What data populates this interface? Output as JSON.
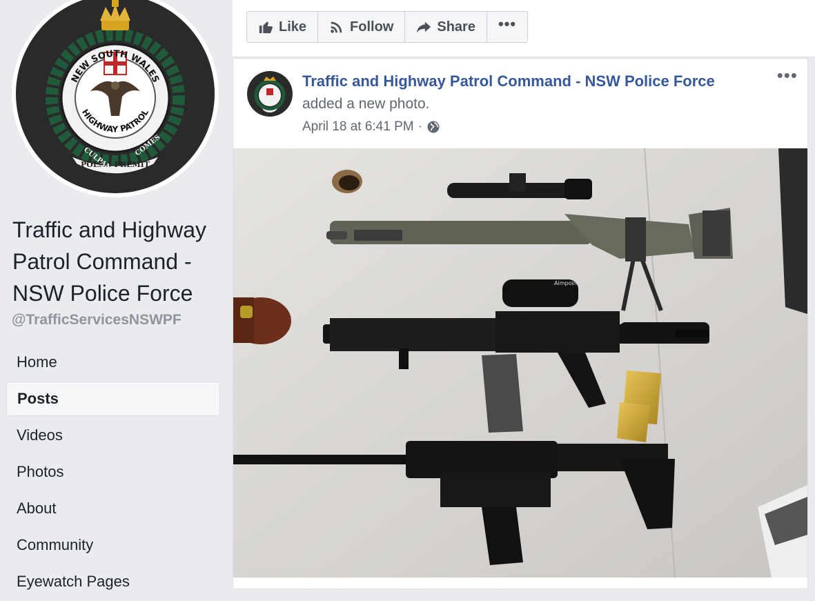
{
  "page": {
    "name": "Traffic and Highway Patrol Command - NSW Police Force",
    "handle": "@TrafficServicesNSWPF"
  },
  "badge": {
    "text_top": "NEW SOUTH WALES",
    "text_bottom": "HIGHWAY PATROL",
    "motto_left": "CULPAM",
    "motto_center": "POENA PREMIT",
    "motto_right": "COMES"
  },
  "nav": {
    "items": [
      {
        "label": "Home"
      },
      {
        "label": "Posts"
      },
      {
        "label": "Videos"
      },
      {
        "label": "Photos"
      },
      {
        "label": "About"
      },
      {
        "label": "Community"
      },
      {
        "label": "Eyewatch Pages"
      }
    ],
    "active": "Posts"
  },
  "actions": {
    "like": "Like",
    "follow": "Follow",
    "share": "Share",
    "more": "•••"
  },
  "post": {
    "author": "Traffic and Highway Patrol Command - NSW Police Force",
    "action": "added a new photo.",
    "timestamp": "April 18 at 6:41 PM",
    "separator": "·",
    "menu": "•••",
    "photo_label": "Aimpoint"
  },
  "colors": {
    "background": "#e9ebee",
    "link": "#365899",
    "badge_dark": "#2a2a2a",
    "laurel": "#1f5a3a"
  },
  "icons": {
    "like": "thumbs-up-icon",
    "follow": "rss-icon",
    "share": "share-arrow-icon",
    "audience": "globe-icon"
  }
}
